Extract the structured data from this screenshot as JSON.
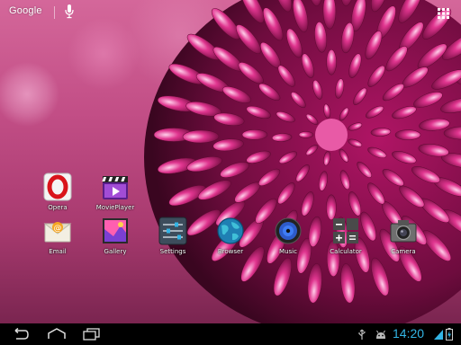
{
  "colors": {
    "clock": "#33b5e5",
    "navbar_background": "#000000",
    "wallpaper_pink": "#c24e86",
    "petal_magenta": "#d1207a"
  },
  "search_bar": {
    "label": "Google",
    "icons": [
      "mic-icon"
    ]
  },
  "app_drawer_icon": "apps-grid-icon",
  "apps": [
    {
      "label": "Opera",
      "icon": "opera-icon"
    },
    {
      "label": "MoviePlayer",
      "icon": "movieplayer-icon"
    },
    {
      "label": "Email",
      "icon": "email-icon"
    },
    {
      "label": "Gallery",
      "icon": "gallery-icon"
    },
    {
      "label": "Settings",
      "icon": "settings-icon"
    },
    {
      "label": "Browser",
      "icon": "browser-icon"
    },
    {
      "label": "Music",
      "icon": "music-icon"
    },
    {
      "label": "Calculator",
      "icon": "calculator-icon"
    },
    {
      "label": "Camera",
      "icon": "camera-icon"
    }
  ],
  "navigation_bar": {
    "buttons": [
      "back-icon",
      "home-icon",
      "recent-apps-icon"
    ],
    "status_icons": [
      "usb-icon",
      "android-debug-icon",
      "wifi-icon",
      "battery-icon"
    ],
    "clock": "14:20"
  }
}
